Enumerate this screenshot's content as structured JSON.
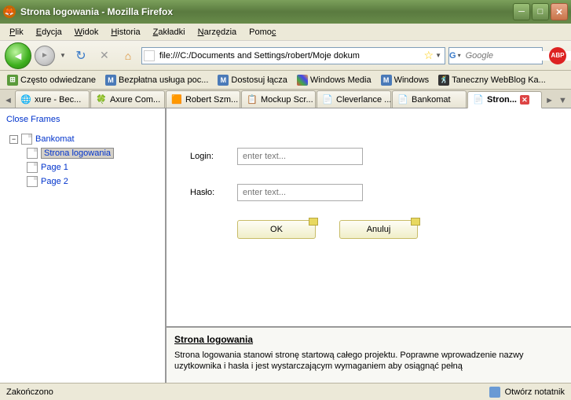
{
  "window": {
    "title": "Strona logowania - Mozilla Firefox"
  },
  "menubar": [
    "Plik",
    "Edycja",
    "Widok",
    "Historia",
    "Zakładki",
    "Narzędzia",
    "Pomoc"
  ],
  "urlbar": {
    "value": "file:///C:/Documents and Settings/robert/Moje dokum"
  },
  "searchbox": {
    "placeholder": "Google"
  },
  "bookmarks": [
    {
      "label": "Często odwiedzane",
      "icon": "freq"
    },
    {
      "label": "Bezpłatna usługa poc...",
      "icon": "M"
    },
    {
      "label": "Dostosuj łącza",
      "icon": "M"
    },
    {
      "label": "Windows Media",
      "icon": "wm"
    },
    {
      "label": "Windows",
      "icon": "M"
    },
    {
      "label": "Taneczny WebBlog Ka...",
      "icon": "dance"
    }
  ],
  "tabs": [
    {
      "label": "xure - Bec...",
      "active": false
    },
    {
      "label": "Axure Com...",
      "active": false
    },
    {
      "label": "Robert Szm...",
      "active": false
    },
    {
      "label": "Mockup Scr...",
      "active": false
    },
    {
      "label": "Cleverlance ...",
      "active": false
    },
    {
      "label": "Bankomat",
      "active": false
    },
    {
      "label": "Stron...",
      "active": true
    }
  ],
  "sidebar": {
    "close_label": "Close Frames",
    "root": "Bankomat",
    "pages": [
      "Strona logowania",
      "Page 1",
      "Page 2"
    ],
    "selected_index": 0
  },
  "form": {
    "login_label": "Login:",
    "password_label": "Hasło:",
    "placeholder": "enter text...",
    "ok_label": "OK",
    "cancel_label": "Anuluj"
  },
  "notes": {
    "title": "Strona logowania",
    "body": "Strona logowania stanowi stronę startową całego projektu. Poprawne wprowadzenie nazwy uzytkownika i hasła i jest wystarczającym wymaganiem aby osiągnąć pełną"
  },
  "statusbar": {
    "left": "Zakończono",
    "right": "Otwórz notatnik"
  }
}
